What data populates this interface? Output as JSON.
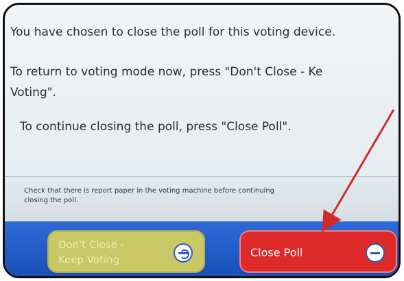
{
  "message": {
    "line1": "You have chosen to close the poll for this voting device.",
    "line2": "To return to voting mode now, press \"Don't Close - Ke",
    "line3": "Voting\".",
    "line4": "To continue closing the poll, press \"Close Poll\"."
  },
  "note": {
    "line1": "Check that there is report paper in the voting machine before continuing",
    "line2": "closing the poll."
  },
  "buttons": {
    "keep": {
      "line1": "Don't Close -",
      "line2": "Keep Voting",
      "icon": "refresh-icon"
    },
    "close": {
      "label": "Close Poll",
      "icon": "minus-icon"
    }
  },
  "colors": {
    "close_button": "#df2a2a",
    "keep_button": "#c9c766",
    "toolbar": "#1a4fb7",
    "annotation_arrow": "#d22a2a"
  }
}
